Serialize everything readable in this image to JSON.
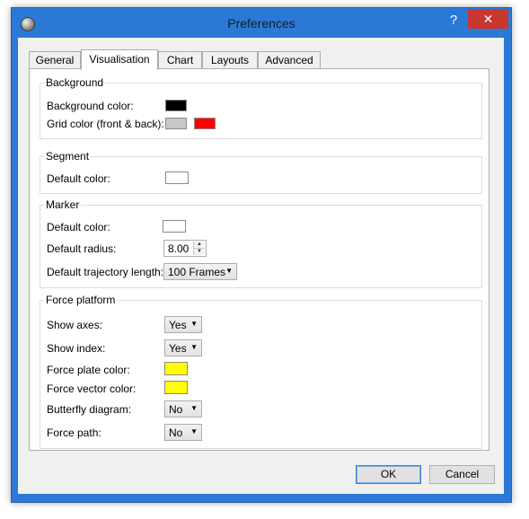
{
  "window": {
    "title": "Preferences",
    "help_symbol": "?",
    "close_symbol": "✕"
  },
  "tabs": [
    {
      "label": "General"
    },
    {
      "label": "Visualisation"
    },
    {
      "label": "Chart"
    },
    {
      "label": "Layouts"
    },
    {
      "label": "Advanced"
    }
  ],
  "active_tab": "Visualisation",
  "background": {
    "title": "Background",
    "bg_color_label": "Background color:",
    "bg_color": "#000000",
    "grid_color_label": "Grid color (front & back):",
    "grid_front_color": "#c8c8c8",
    "grid_back_color": "#ff0000"
  },
  "segment": {
    "title": "Segment",
    "default_color_label": "Default color:",
    "default_color": "#ffffff"
  },
  "marker": {
    "title": "Marker",
    "default_color_label": "Default color:",
    "default_color": "#ffffff",
    "default_radius_label": "Default radius:",
    "default_radius_value": "8.00",
    "trajectory_label": "Default trajectory length:",
    "trajectory_value": "100 Frames"
  },
  "force_platform": {
    "title": "Force platform",
    "show_axes_label": "Show axes:",
    "show_axes_value": "Yes",
    "show_index_label": "Show index:",
    "show_index_value": "Yes",
    "plate_color_label": "Force plate color:",
    "plate_color": "#ffff00",
    "vector_color_label": "Force vector color:",
    "vector_color": "#ffff00",
    "butterfly_label": "Butterfly diagram:",
    "butterfly_value": "No",
    "path_label": "Force path:",
    "path_value": "No"
  },
  "buttons": {
    "ok_label": "OK",
    "cancel_label": "Cancel"
  }
}
